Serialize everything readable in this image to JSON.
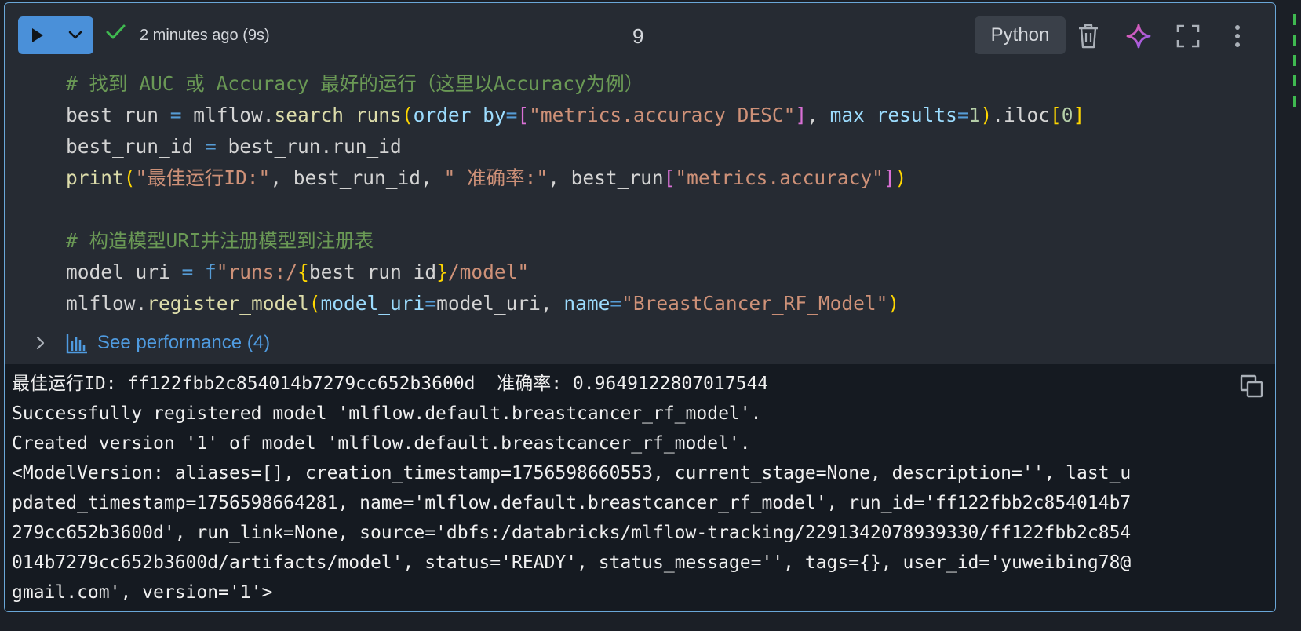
{
  "cell": {
    "status_text": "2 minutes ago (9s)",
    "execution_count": "9",
    "language": "Python"
  },
  "code_lines": [
    [
      {
        "t": "# 找到 AUC 或 Accuracy 最好的运行（这里以Accuracy为例）",
        "c": "cm"
      }
    ],
    [
      {
        "t": "best_run ",
        "c": ""
      },
      {
        "t": "= ",
        "c": "kw"
      },
      {
        "t": "mlflow.",
        "c": ""
      },
      {
        "t": "search_runs",
        "c": "fn"
      },
      {
        "t": "(",
        "c": "b1"
      },
      {
        "t": "order_by",
        "c": "pm"
      },
      {
        "t": "=",
        "c": "kw"
      },
      {
        "t": "[",
        "c": "b2"
      },
      {
        "t": "\"metrics.accuracy DESC\"",
        "c": "st"
      },
      {
        "t": "]",
        "c": "b2"
      },
      {
        "t": ", ",
        "c": ""
      },
      {
        "t": "max_results",
        "c": "pm"
      },
      {
        "t": "=",
        "c": "kw"
      },
      {
        "t": "1",
        "c": "nm"
      },
      {
        "t": ")",
        "c": "b1"
      },
      {
        "t": ".iloc",
        "c": ""
      },
      {
        "t": "[",
        "c": "b1"
      },
      {
        "t": "0",
        "c": "nm"
      },
      {
        "t": "]",
        "c": "b1"
      }
    ],
    [
      {
        "t": "best_run_id ",
        "c": ""
      },
      {
        "t": "= ",
        "c": "kw"
      },
      {
        "t": "best_run.run_id",
        "c": ""
      }
    ],
    [
      {
        "t": "print",
        "c": "fn"
      },
      {
        "t": "(",
        "c": "b1"
      },
      {
        "t": "\"最佳运行ID:\"",
        "c": "st"
      },
      {
        "t": ", best_run_id, ",
        "c": ""
      },
      {
        "t": "\" 准确率:\"",
        "c": "st"
      },
      {
        "t": ", best_run",
        "c": ""
      },
      {
        "t": "[",
        "c": "b2"
      },
      {
        "t": "\"metrics.accuracy\"",
        "c": "st"
      },
      {
        "t": "]",
        "c": "b2"
      },
      {
        "t": ")",
        "c": "b1"
      }
    ],
    [],
    [
      {
        "t": "# 构造模型URI并注册模型到注册表",
        "c": "cm"
      }
    ],
    [
      {
        "t": "model_uri ",
        "c": ""
      },
      {
        "t": "= ",
        "c": "kw"
      },
      {
        "t": "f",
        "c": "kw"
      },
      {
        "t": "\"runs:/",
        "c": "st"
      },
      {
        "t": "{",
        "c": "b1"
      },
      {
        "t": "best_run_id",
        "c": ""
      },
      {
        "t": "}",
        "c": "b1"
      },
      {
        "t": "/model\"",
        "c": "st"
      }
    ],
    [
      {
        "t": "mlflow.",
        "c": ""
      },
      {
        "t": "register_model",
        "c": "fn"
      },
      {
        "t": "(",
        "c": "b1"
      },
      {
        "t": "model_uri",
        "c": "pm"
      },
      {
        "t": "=",
        "c": "kw"
      },
      {
        "t": "model_uri, ",
        "c": ""
      },
      {
        "t": "name",
        "c": "pm"
      },
      {
        "t": "=",
        "c": "kw"
      },
      {
        "t": "\"BreastCancer_RF_Model\"",
        "c": "st"
      },
      {
        "t": ")",
        "c": "b1"
      }
    ]
  ],
  "performance": {
    "label": "See performance (4)"
  },
  "output": {
    "lines": [
      "最佳运行ID: ff122fbb2c854014b7279cc652b3600d  准确率: 0.9649122807017544",
      "Successfully registered model 'mlflow.default.breastcancer_rf_model'.",
      "Created version '1' of model 'mlflow.default.breastcancer_rf_model'.",
      "<ModelVersion: aliases=[], creation_timestamp=1756598660553, current_stage=None, description='', last_u",
      "pdated_timestamp=1756598664281, name='mlflow.default.breastcancer_rf_model', run_id='ff122fbb2c854014b7",
      "279cc652b3600d', run_link=None, source='dbfs:/databricks/mlflow-tracking/2291342078939330/ff122fbb2c854",
      "014b7279cc652b3600d/artifacts/model', status='READY', status_message='', tags={}, user_id='yuweibing78@",
      "gmail.com', version='1'>"
    ]
  },
  "icons": {
    "run": "play-icon",
    "run_menu": "chevron-down-icon",
    "status": "check-icon",
    "delete": "trash-icon",
    "assistant": "sparkle-icon",
    "fullscreen": "expand-icon",
    "more": "kebab-menu-icon",
    "performance": "bar-chart-icon",
    "expand_perf": "chevron-right-icon",
    "copy": "copy-icon"
  },
  "colors": {
    "accent": "#4a90d9",
    "cell_border": "#6aa7d8",
    "success": "#3fb950",
    "assistant_gradient": [
      "#ec5ca6",
      "#8b5cf6"
    ]
  }
}
